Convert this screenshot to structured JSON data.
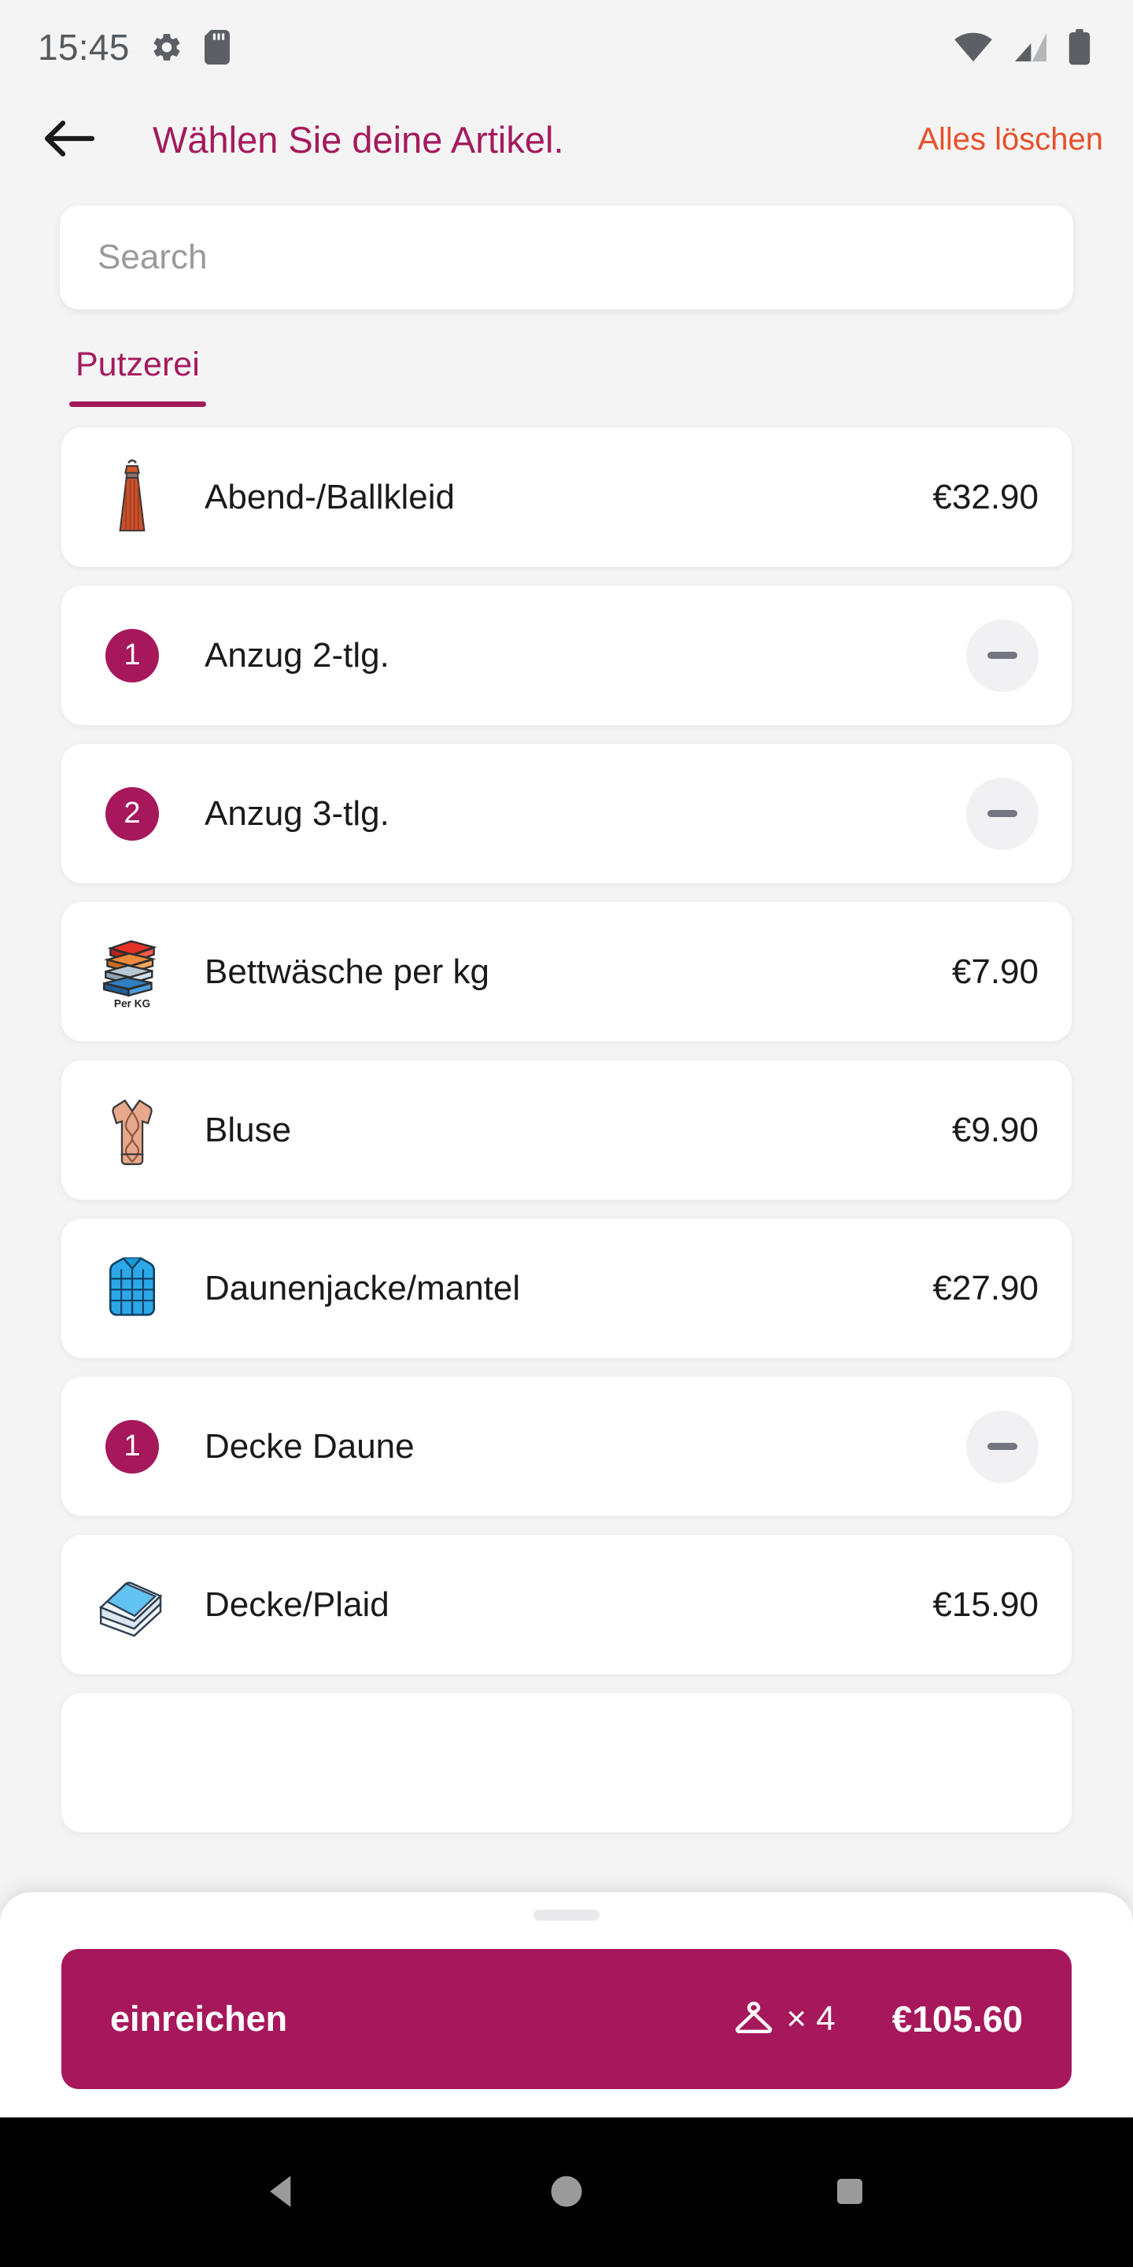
{
  "status_bar": {
    "time": "15:45",
    "left_icons": [
      "gear-icon",
      "sd-card-icon"
    ],
    "right_icons": [
      "wifi-icon",
      "cellular-signal-icon",
      "battery-icon"
    ]
  },
  "app_bar": {
    "back_icon": "arrow-left-icon",
    "title": "Wählen Sie deine Artikel.",
    "clear_all_label": "Alles löschen"
  },
  "search": {
    "placeholder": "Search",
    "value": ""
  },
  "tabs": [
    {
      "label": "Putzerei",
      "active": true
    }
  ],
  "items": [
    {
      "name": "Abend-/Ballkleid",
      "price": "€32.90",
      "qty": null,
      "icon": "evening-dress-icon"
    },
    {
      "name": "Anzug 2-tlg.",
      "price": null,
      "qty": "1",
      "icon": "quantity-badge"
    },
    {
      "name": "Anzug 3-tlg.",
      "price": null,
      "qty": "2",
      "icon": "quantity-badge"
    },
    {
      "name": "Bettwäsche per kg",
      "price": "€7.90",
      "qty": null,
      "icon": "folded-linens-icon"
    },
    {
      "name": "Bluse",
      "price": "€9.90",
      "qty": null,
      "icon": "blouse-icon"
    },
    {
      "name": "Daunenjacke/mantel",
      "price": "€27.90",
      "qty": null,
      "icon": "puffer-jacket-icon"
    },
    {
      "name": "Decke Daune",
      "price": null,
      "qty": "1",
      "icon": "quantity-badge"
    },
    {
      "name": "Decke/Plaid",
      "price": "€15.90",
      "qty": null,
      "icon": "folded-blanket-icon"
    }
  ],
  "linens_icon_label": "Per KG",
  "bottom_sheet": {
    "submit_label": "einreichen",
    "hanger_icon": "clothes-hanger-icon",
    "count_label": "× 4",
    "total": "€105.60"
  },
  "nav_bar": {
    "back_label": "back-triangle-icon",
    "home_label": "home-circle-icon",
    "recents_label": "recents-square-icon"
  },
  "colors": {
    "brand_magenta": "#a6185b",
    "title_magenta": "#a51a5d",
    "accent_orange": "#e8502a",
    "page_bg": "#f4f4f4",
    "card_bg": "#ffffff",
    "minus_btn_bg": "#f1f1f3"
  }
}
